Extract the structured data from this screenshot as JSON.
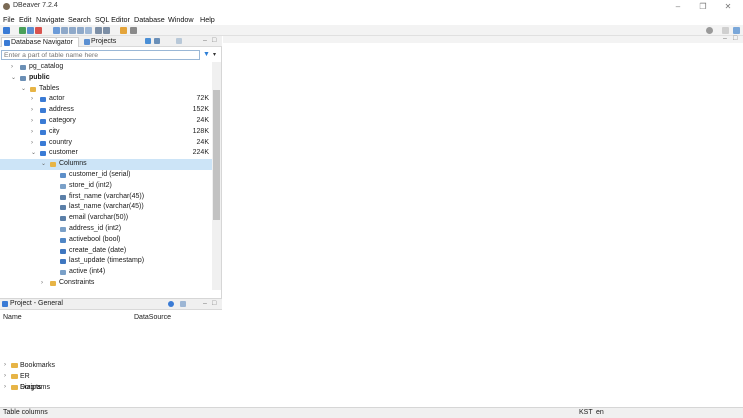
{
  "window": {
    "title": "DBeaver 7.2.4"
  },
  "menu": [
    "File",
    "Edit",
    "Navigate",
    "Search",
    "SQL Editor",
    "Database",
    "Window",
    "Help"
  ],
  "navigator": {
    "tabs": [
      {
        "label": "Database Navigator",
        "active": true
      },
      {
        "label": "Projects",
        "active": false
      }
    ],
    "filter_placeholder": "Enter a part of table name here",
    "tree": [
      {
        "label": "pg_catalog",
        "depth": 1,
        "icon": "schema-icon",
        "expanded": false,
        "size": ""
      },
      {
        "label": "public",
        "depth": 1,
        "icon": "schema-icon",
        "expanded": true,
        "bold": true,
        "size": ""
      },
      {
        "label": "Tables",
        "depth": 2,
        "icon": "folder-icon",
        "expanded": true,
        "size": ""
      },
      {
        "label": "actor",
        "depth": 3,
        "icon": "table-icon",
        "expanded": false,
        "size": "72K"
      },
      {
        "label": "address",
        "depth": 3,
        "icon": "table-icon",
        "expanded": false,
        "size": "152K"
      },
      {
        "label": "category",
        "depth": 3,
        "icon": "table-icon",
        "expanded": false,
        "size": "24K"
      },
      {
        "label": "city",
        "depth": 3,
        "icon": "table-icon",
        "expanded": false,
        "size": "128K"
      },
      {
        "label": "country",
        "depth": 3,
        "icon": "table-icon",
        "expanded": false,
        "size": "24K"
      },
      {
        "label": "customer",
        "depth": 3,
        "icon": "table-icon",
        "expanded": true,
        "size": "224K"
      },
      {
        "label": "Columns",
        "depth": 4,
        "icon": "folder-icon",
        "expanded": true,
        "selected": true,
        "size": ""
      },
      {
        "label": "customer_id (serial)",
        "depth": 5,
        "icon": "pk-column-icon",
        "size": ""
      },
      {
        "label": "store_id (int2)",
        "depth": 5,
        "icon": "number-column-icon",
        "size": ""
      },
      {
        "label": "first_name (varchar(45))",
        "depth": 5,
        "icon": "text-column-icon",
        "size": ""
      },
      {
        "label": "last_name (varchar(45))",
        "depth": 5,
        "icon": "text-column-icon",
        "size": ""
      },
      {
        "label": "email (varchar(50))",
        "depth": 5,
        "icon": "text-column-icon",
        "size": ""
      },
      {
        "label": "address_id (int2)",
        "depth": 5,
        "icon": "number-column-icon",
        "size": ""
      },
      {
        "label": "activebool (bool)",
        "depth": 5,
        "icon": "bool-column-icon",
        "size": ""
      },
      {
        "label": "create_date (date)",
        "depth": 5,
        "icon": "date-column-icon",
        "size": ""
      },
      {
        "label": "last_update (timestamp)",
        "depth": 5,
        "icon": "date-column-icon",
        "size": ""
      },
      {
        "label": "active (int4)",
        "depth": 5,
        "icon": "number-column-icon",
        "size": ""
      },
      {
        "label": "Constraints",
        "depth": 4,
        "icon": "folder-icon",
        "expanded": false,
        "size": ""
      }
    ]
  },
  "project": {
    "tab_label": "Project - General",
    "columns": [
      "Name",
      "DataSource"
    ],
    "items": [
      "Bookmarks",
      "ER Diagrams",
      "Scripts"
    ]
  },
  "status": {
    "left": "Table columns",
    "tz": "KST",
    "locale": "en"
  },
  "colors": {
    "selection": "#cce4f7",
    "accent": "#2d7ed6",
    "folder": "#e7b446"
  }
}
